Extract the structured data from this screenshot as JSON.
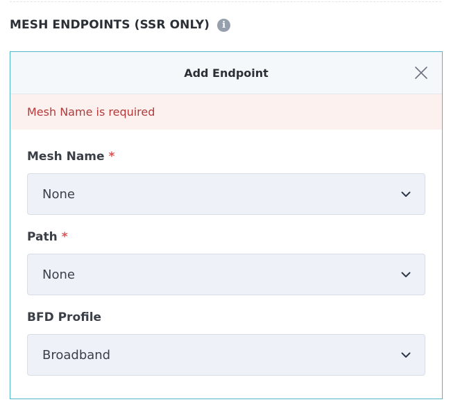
{
  "section": {
    "title": "MESH ENDPOINTS (SSR ONLY)",
    "info_icon": "i"
  },
  "panel": {
    "title": "Add Endpoint",
    "close_icon": "close-icon",
    "error_message": "Mesh Name is required"
  },
  "form": {
    "fields": [
      {
        "label": "Mesh Name",
        "required_mark": "*",
        "value": "None"
      },
      {
        "label": "Path",
        "required_mark": "*",
        "value": "None"
      },
      {
        "label": "BFD Profile",
        "required_mark": "",
        "value": "Broadband"
      }
    ]
  },
  "colors": {
    "panel_border": "#4fb6c4",
    "error_background": "#fdf1f0",
    "error_text": "#b03a3a",
    "required": "#e05252",
    "select_background": "#eef2f8"
  }
}
